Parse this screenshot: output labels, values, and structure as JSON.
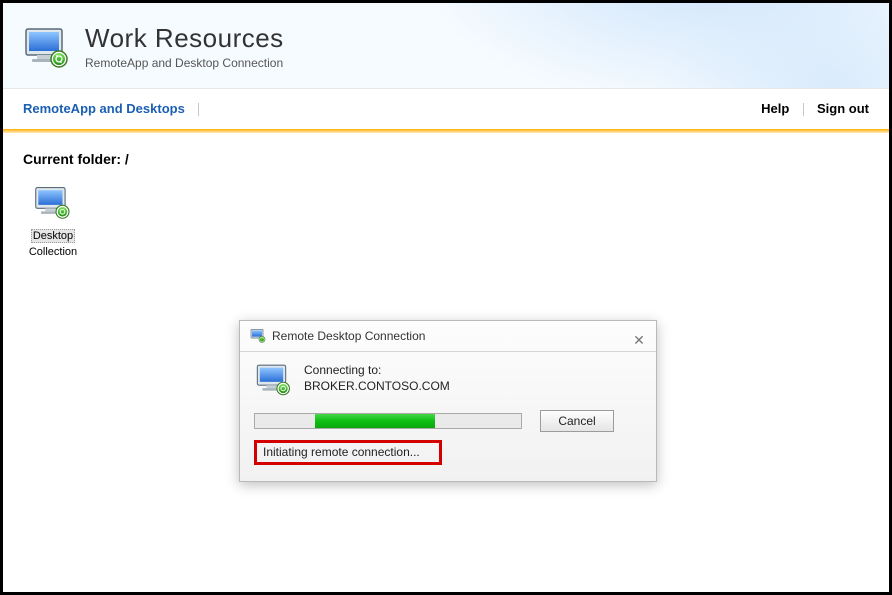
{
  "header": {
    "title": "Work Resources",
    "subtitle": "RemoteApp and Desktop Connection"
  },
  "nav": {
    "primary": "RemoteApp and Desktops",
    "help": "Help",
    "signout": "Sign out"
  },
  "main": {
    "current_folder_label": "Current folder: /",
    "items": [
      {
        "line1": "Desktop",
        "line2": "Collection"
      }
    ]
  },
  "dialog": {
    "title": "Remote Desktop Connection",
    "connecting_label": "Connecting to:",
    "host": "BROKER.CONTOSO.COM",
    "cancel": "Cancel",
    "status": "Initiating remote connection..."
  }
}
